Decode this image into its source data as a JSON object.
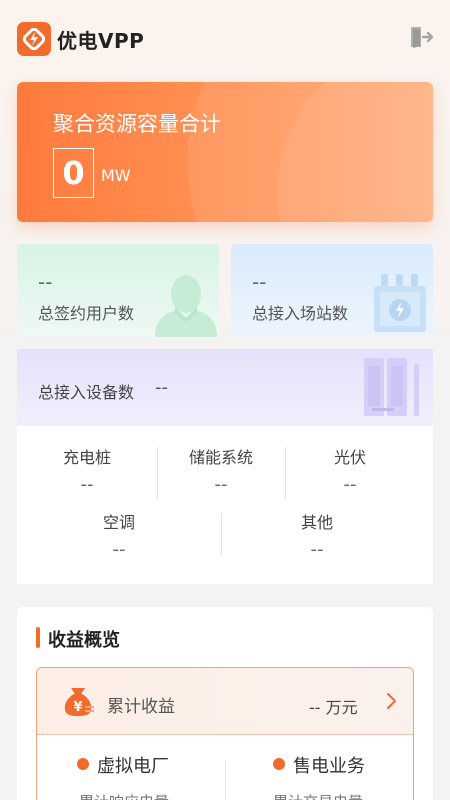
{
  "header": {
    "app_title": "优电VPP"
  },
  "capacity": {
    "title": "聚合资源容量合计",
    "value": "0",
    "unit": "MW"
  },
  "stats": {
    "users": {
      "value": "--",
      "label": "总签约用户数"
    },
    "sites": {
      "value": "--",
      "label": "总接入场站数"
    }
  },
  "devices": {
    "label": "总接入设备数",
    "value": "--",
    "items": [
      {
        "label": "充电桩",
        "value": "--"
      },
      {
        "label": "储能系统",
        "value": "--"
      },
      {
        "label": "光伏",
        "value": "--"
      },
      {
        "label": "空调",
        "value": "--"
      },
      {
        "label": "其他",
        "value": "--"
      }
    ]
  },
  "revenue": {
    "title": "收益概览",
    "cumulative_label": "累计收益",
    "cumulative_value": "-- 万元",
    "businesses": [
      {
        "label": "虚拟电厂",
        "sub": "累计响应电量"
      },
      {
        "label": "售电业务",
        "sub": "累计交易电量"
      }
    ]
  },
  "colors": {
    "accent": "#f26a2c",
    "card_orange": "#ff8a4c",
    "card_green": "#d8f3e5",
    "card_blue": "#d9ebfb",
    "card_purple": "#e5e1fb"
  },
  "icons": {
    "logo": "brand-logo-icon",
    "logout": "logout-icon",
    "user": "user-silhouette-icon",
    "site": "substation-icon",
    "device": "cabinet-icon",
    "money": "money-bag-icon",
    "arrow": "chevron-right-icon"
  }
}
